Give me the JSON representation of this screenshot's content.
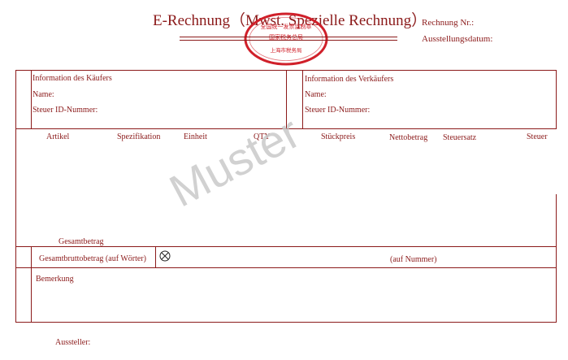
{
  "title": "E-Rechnung（Mwst. Spezielle Rechnung）",
  "invoice_number_label": "Rechnung Nr.:",
  "issue_date_label": "Ausstellungsdatum:",
  "buyer": {
    "heading": "Information des Käufers",
    "name_label": "Name:",
    "tax_id_label": "Steuer ID-Nummer:"
  },
  "seller": {
    "heading": "Information des Verkäufers",
    "name_label": "Name:",
    "tax_id_label": "Steuer ID-Nummer:"
  },
  "columns": [
    "Artikel",
    "Spezifikation",
    "Einheit",
    "QTY",
    "Stückpreis",
    "Nettobetrag",
    "Steuersatz",
    "Steuer"
  ],
  "total_label": "Gesamtbetrag",
  "gross_total_words_label": "Gesamtbruttobetrag (auf Wörter)",
  "gross_total_number_label": "(auf Nummer)",
  "remarks_label": "Bemerkung",
  "issuer_label": "Aussteller:",
  "watermark": "Muster",
  "seal_text": {
    "top": "全国统一发票监制章",
    "middle": "国家税务总局",
    "bottom": "上海市税务局"
  },
  "colors": {
    "accent": "#8b1a1a",
    "seal": "#d0202a",
    "watermark": "#c9c9c9"
  }
}
